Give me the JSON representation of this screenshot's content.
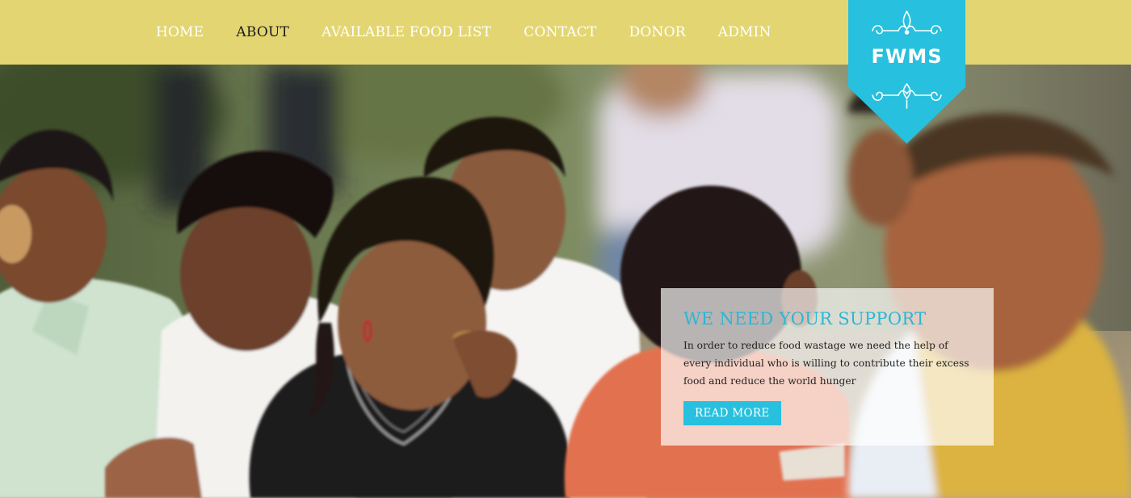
{
  "nav": {
    "items": [
      {
        "label": "HOME",
        "active": false
      },
      {
        "label": "ABOUT",
        "active": true
      },
      {
        "label": "AVAILABLE FOOD LIST",
        "active": false
      },
      {
        "label": "CONTACT",
        "active": false
      },
      {
        "label": "DONOR",
        "active": false
      },
      {
        "label": "ADMIN",
        "active": false
      }
    ]
  },
  "logo": {
    "text": "FWMS",
    "color": "#27c0de"
  },
  "hero": {
    "image": "children-eating-photo"
  },
  "panel": {
    "title": "WE NEED YOUR SUPPORT",
    "text": "In order to reduce food wastage we need the help of every individual who is willing to contribute their excess food and reduce the world hunger",
    "button": "READ MORE"
  },
  "colors": {
    "header": "#e3d672",
    "accent": "#27c0de",
    "nav_text": "#ffffff",
    "nav_active": "#1b1b1b"
  }
}
